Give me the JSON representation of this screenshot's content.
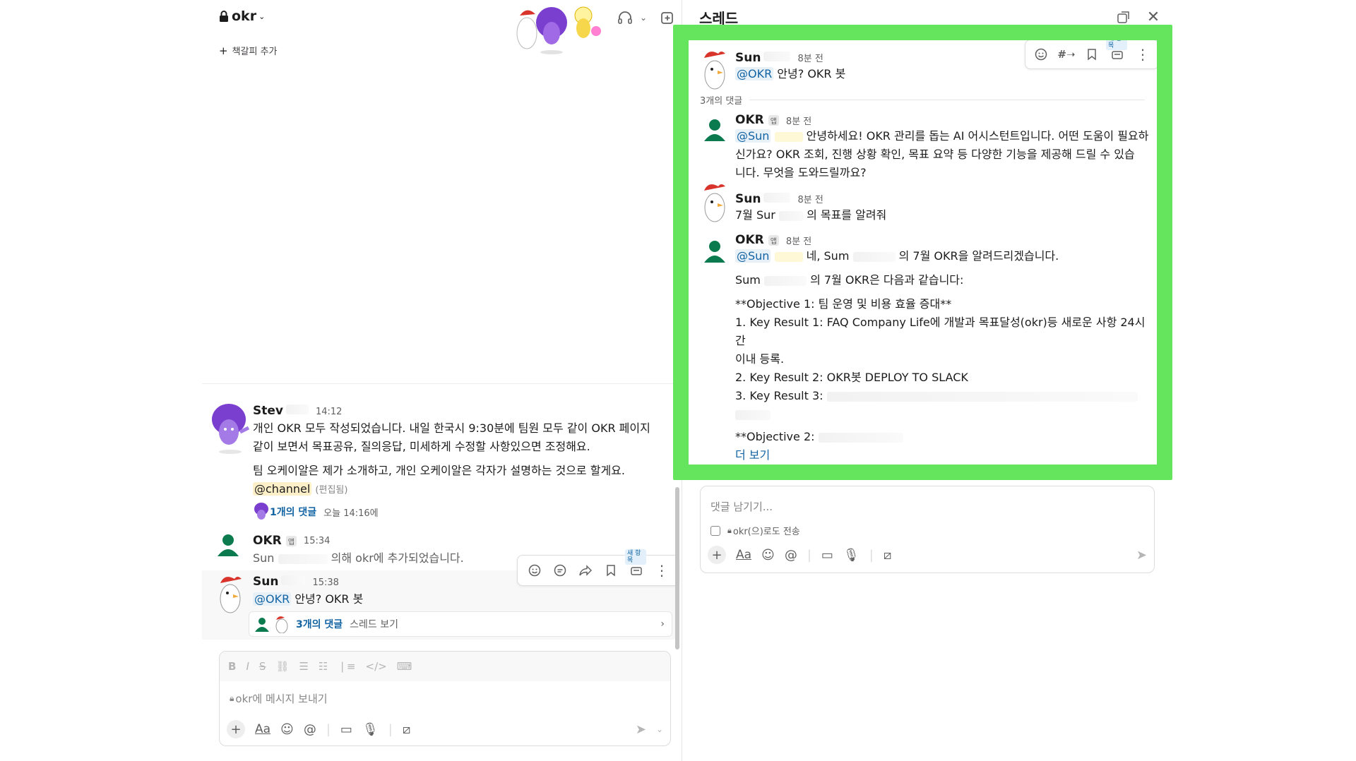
{
  "channel": {
    "name": "okr",
    "bookmark_add": "책갈피 추가"
  },
  "messages": [
    {
      "author": "Stev",
      "time": "14:12",
      "line1": "개인 OKR 모두 작성되었습니다. 내일 한국시 9:30분에 팀원 모두 같이 OKR 페이지",
      "line2": "같이 보면서 목표공유, 질의응답, 미세하게 수정할 사항있으면 조정해요.",
      "line3": "팀 오케이알은 제가 소개하고, 개인 오케이알은 각자가 설명하는 것으로 할게요.",
      "mention": "@channel",
      "edited": "(편집됨)",
      "reply_count": "1개의 댓글",
      "reply_time": "오늘 14:16에"
    },
    {
      "author": "OKR",
      "app_badge": "앱",
      "time": "15:34",
      "prefix": "Sun",
      "text": "의해 okr에 추가되었습니다."
    },
    {
      "author": "Sun",
      "time": "15:38",
      "mention": "@OKR",
      "text": "안녕? OKR 봇",
      "reply_count": "3개의 댓글",
      "view_thread": "스레드 보기"
    }
  ],
  "hover_toolbar": {
    "new_badge": "새 항목"
  },
  "composer": {
    "placeholder": "okr에 메시지 보내기"
  },
  "thread": {
    "title": "스레드",
    "root": {
      "author": "Sun",
      "time": "8분 전",
      "mention": "@OKR",
      "text": "안녕? OKR 봇"
    },
    "reply_divider": "3개의 댓글",
    "replies": [
      {
        "author": "OKR",
        "app_badge": "앱",
        "time": "8분 전",
        "mention": "@Sun",
        "line1": "안녕하세요! OKR 관리를 돕는 AI 어시스턴트입니다. 어떤 도움이 필요하",
        "line2": "신가요? OKR 조회, 진행 상황 확인, 목표 요약 등 다양한 기능을 제공해 드릴 수 있습",
        "line3": "니다. 무엇을 도와드릴까요?"
      },
      {
        "author": "Sun",
        "time": "8분 전",
        "text_a": "7월 Sur",
        "text_b": "의 목표를 알려줘"
      },
      {
        "author": "OKR",
        "app_badge": "앱",
        "time": "8분 전",
        "mention": "@Sun",
        "text_a": "네, Sum",
        "text_b": "의 7월 OKR을 알려드리겠습니다.",
        "summary_a": "Sum",
        "summary_b": "의 7월 OKR은 다음과 같습니다:",
        "objective1": "**Objective 1: 팀 운영 및 비용 효율 증대**",
        "kr1_line1": "1. Key Result 1: FAQ Company Life에 개발과 목표달성(okr)등 새로운 사항 24시간",
        "kr1_line2": "이내 등록.",
        "kr2": "2. Key Result 2: OKR봇 DEPLOY TO SLACK",
        "kr3": "3. Key Result 3:",
        "objective2": "**Objective 2:",
        "more": "더 보기"
      }
    ],
    "reply_placeholder": "댓글 남기기...",
    "also_send": "okr(으)로도 전송"
  },
  "toolbar_new": "새 항목"
}
